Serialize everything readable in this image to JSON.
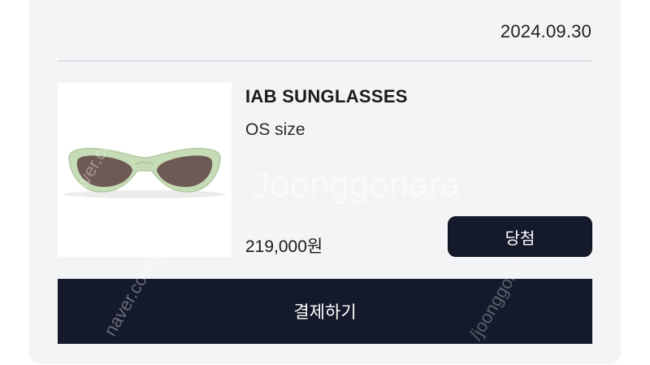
{
  "order": {
    "date": "2024.09.30",
    "product": {
      "name": "IAB SUNGLASSES",
      "size": "OS size",
      "price": "219,000원",
      "image_alt": "sunglasses-image"
    },
    "status_label": "당첨",
    "pay_label": "결제하기"
  },
  "watermark": {
    "text_main": "Joonggonara",
    "text_a": "naver.com/joo",
    "text_b": "naver.com/joon",
    "text_c": "/joonggona"
  },
  "colors": {
    "card_bg": "#f3f4f6",
    "button_bg": "#141a2b",
    "button_text": "#ffffff",
    "frame_green": "#c6dcb6",
    "lens_brown": "#6e5a55"
  }
}
